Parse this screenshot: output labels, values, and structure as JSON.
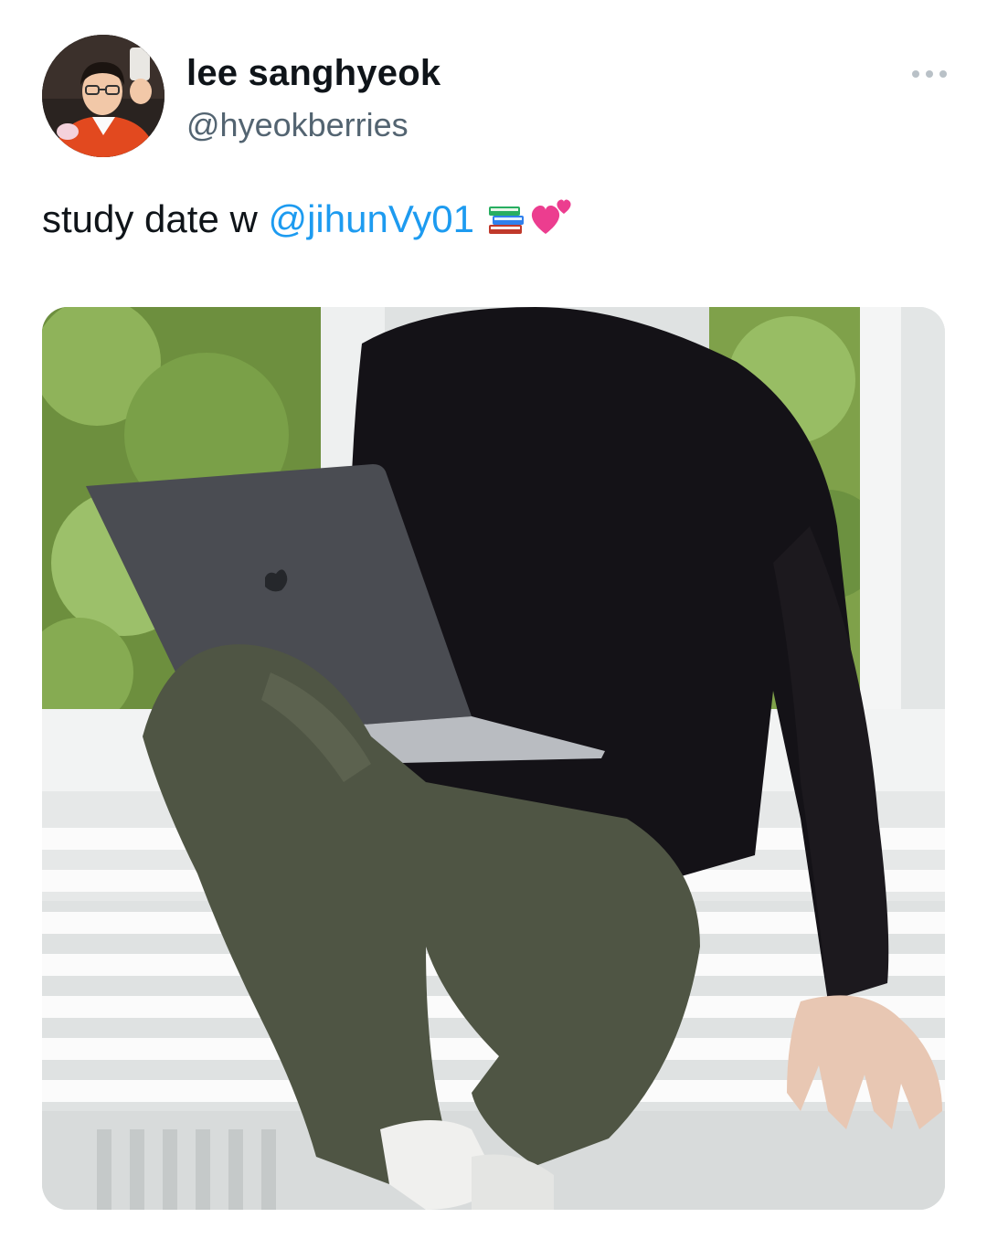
{
  "user": {
    "display_name": "lee sanghyeok",
    "handle": "@hyeokberries"
  },
  "menu": {
    "icon": "more-horizontal-icon"
  },
  "tweet": {
    "text_prefix": "study date w ",
    "mention": "@jihunVy01",
    "emojis": [
      "books-emoji",
      "two-hearts-emoji"
    ]
  },
  "media": {
    "description_icon": "photo"
  },
  "colors": {
    "text": "#0f1419",
    "secondary": "#536471",
    "link": "#1d9bf0"
  }
}
